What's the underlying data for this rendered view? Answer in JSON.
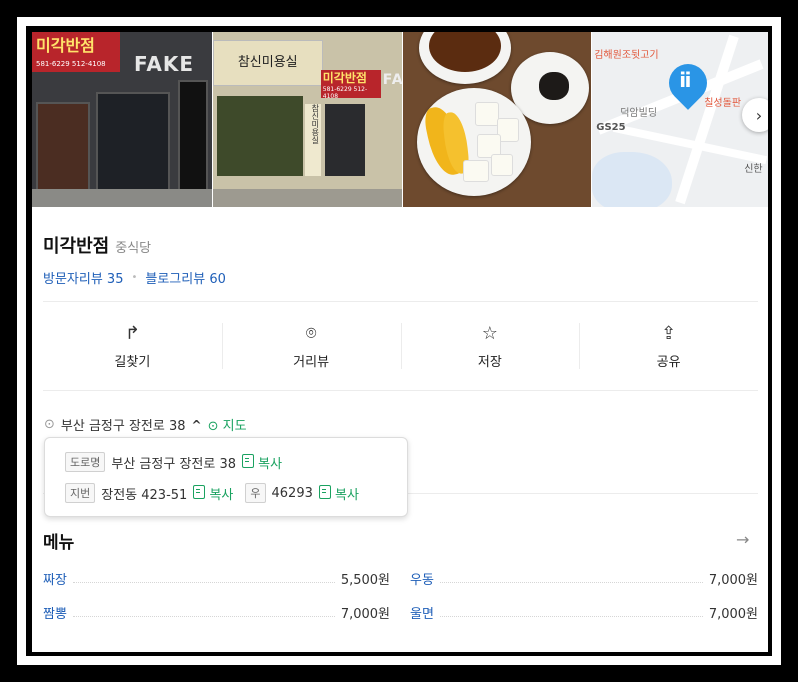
{
  "photos": {
    "photo1": {
      "sign": "미각반점",
      "sign_phone": "581-6229 512-4108",
      "brand": "FAKE"
    },
    "photo2": {
      "sign": "참신미용실",
      "vertical_sign": "참신미용실",
      "shop_sign": "미각반점",
      "shop_phone": "581-6229 512-4108",
      "brand_partial": "FA"
    }
  },
  "map": {
    "labels": [
      "김해원조뒷고기",
      "덕암빌딩",
      "칠성돌판",
      "GS25",
      "신한"
    ],
    "gs_badge": "GS\n25",
    "pin_icon": "restaurant-fork-knife-icon",
    "next_icon": "chevron-right-icon"
  },
  "place": {
    "name": "미각반점",
    "category": "중식당",
    "visitor_review": "방문자리뷰 35",
    "blog_review": "블로그리뷰 60"
  },
  "actions": [
    {
      "label": "길찾기",
      "icon": "directions-arrow-icon"
    },
    {
      "label": "거리뷰",
      "icon": "streetview-pin-icon"
    },
    {
      "label": "저장",
      "icon": "star-icon"
    },
    {
      "label": "공유",
      "icon": "share-icon"
    }
  ],
  "address": {
    "main": "부산 금정구 장전로 38",
    "map_link": "지도",
    "popup": {
      "road_tag": "도로명",
      "road_value": "부산 금정구 장전로 38",
      "copy_label": "복사",
      "lot_tag": "지번",
      "lot_value": "장전동 423-51",
      "zip_tag": "우",
      "zip_value": "46293"
    }
  },
  "menu": {
    "title": "메뉴",
    "items": [
      {
        "name": "짜장",
        "price": "5,500원"
      },
      {
        "name": "우동",
        "price": "7,000원"
      },
      {
        "name": "짬뽕",
        "price": "7,000원"
      },
      {
        "name": "울면",
        "price": "7,000원"
      }
    ]
  },
  "colors": {
    "link_blue": "#1f5fb8",
    "green": "#1aa260",
    "pin_blue": "#2a95e6"
  }
}
